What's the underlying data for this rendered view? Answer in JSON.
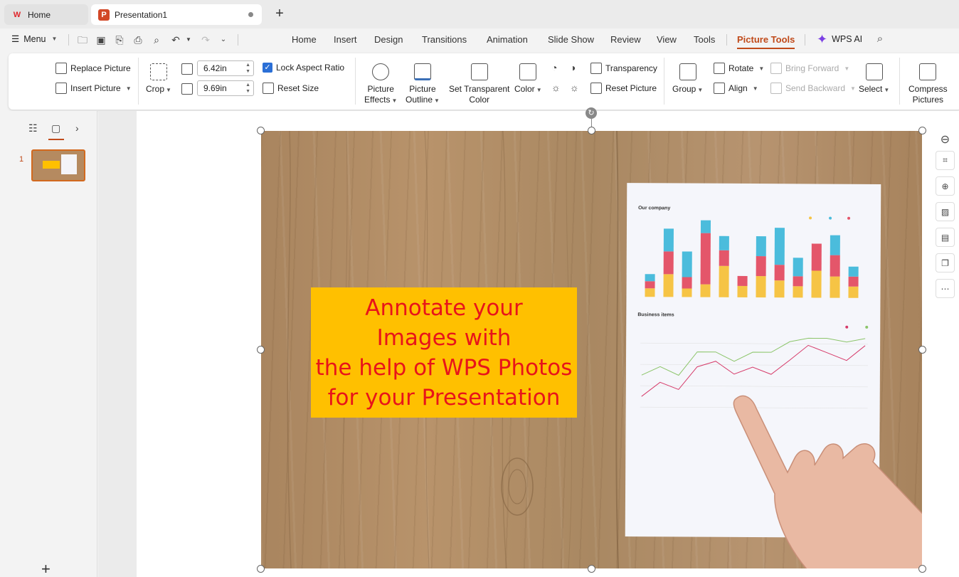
{
  "tabs": {
    "home_label": "Home",
    "doc_label": "Presentation1"
  },
  "menubar": {
    "menu_label": "Menu",
    "ribbon_tabs": [
      "Home",
      "Insert",
      "Design",
      "Transitions",
      "Animation",
      "Slide Show",
      "Review",
      "View",
      "Tools",
      "Picture Tools"
    ],
    "active_tab": "Picture Tools",
    "wps_ai_label": "WPS AI"
  },
  "ribbon": {
    "replace_picture": "Replace Picture",
    "insert_picture": "Insert Picture",
    "crop": "Crop",
    "height_value": "6.42in",
    "width_value": "9.69in",
    "lock_aspect_ratio": "Lock Aspect Ratio",
    "lock_aspect_checked": true,
    "reset_size": "Reset Size",
    "picture_effects_1": "Picture",
    "picture_effects_2": "Effects",
    "picture_outline_1": "Picture",
    "picture_outline_2": "Outline",
    "set_transparent_1": "Set Transparent",
    "set_transparent_2": "Color",
    "color": "Color",
    "transparency": "Transparency",
    "reset_picture": "Reset Picture",
    "group": "Group",
    "rotate": "Rotate",
    "align": "Align",
    "bring_forward": "Bring Forward",
    "send_backward": "Send Backward",
    "select": "Select",
    "compress_1": "Compress",
    "compress_2": "Pictures"
  },
  "slides_panel": {
    "slide_number": "1"
  },
  "slide": {
    "annotation_lines": [
      "Annotate your",
      "Images with",
      "the help of WPS Photos",
      "for your Presentation"
    ],
    "paper_title_1": "Our company",
    "paper_title_2": "Business items"
  },
  "colors": {
    "accent": "#c04a1a",
    "annotation_bg": "#ffc000",
    "annotation_text": "#e8141a",
    "checkbox": "#2b6fd6"
  }
}
